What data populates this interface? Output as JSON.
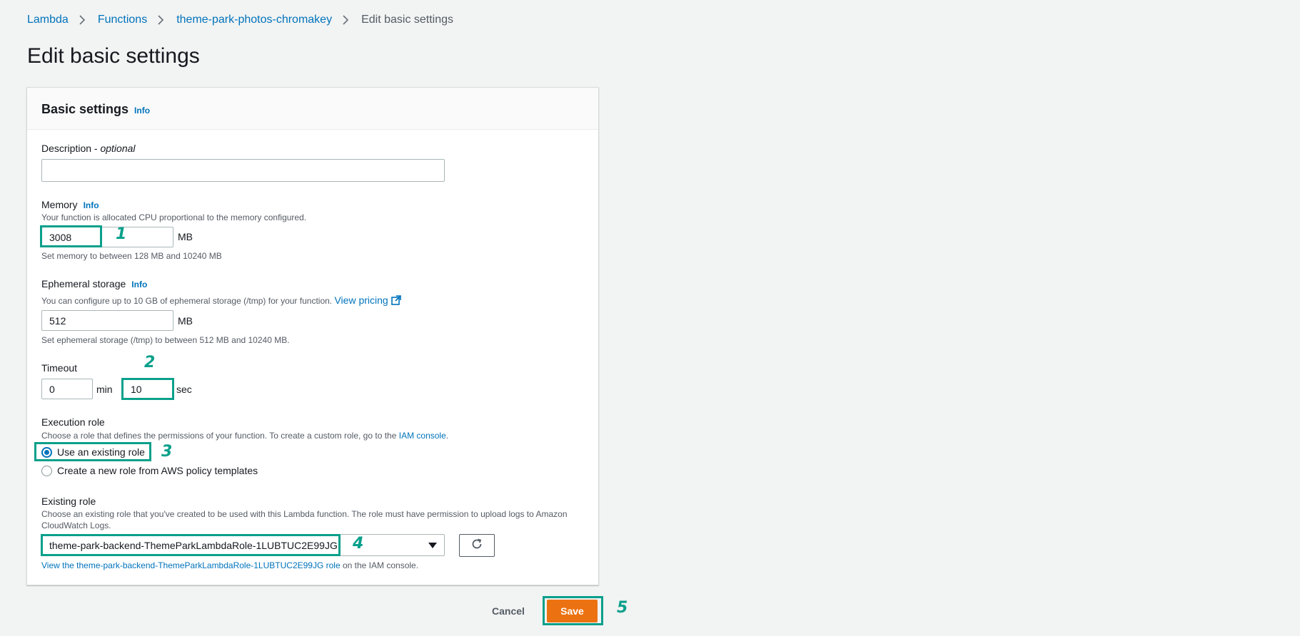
{
  "breadcrumb": {
    "items": [
      "Lambda",
      "Functions",
      "theme-park-photos-chromakey"
    ],
    "current": "Edit basic settings"
  },
  "page_title": "Edit basic settings",
  "panel": {
    "title": "Basic settings",
    "info": "Info"
  },
  "description": {
    "label": "Description - ",
    "optional": "optional",
    "value": ""
  },
  "memory": {
    "label": "Memory",
    "info": "Info",
    "help": "Your function is allocated CPU proportional to the memory configured.",
    "value": "3008",
    "unit": "MB",
    "constraint": "Set memory to between 128 MB and 10240 MB"
  },
  "ephemeral": {
    "label": "Ephemeral storage",
    "info": "Info",
    "help": "You can configure up to 10 GB of ephemeral storage (/tmp) for your function.",
    "pricing_link": "View pricing",
    "value": "512",
    "unit": "MB",
    "constraint": "Set ephemeral storage (/tmp) to between 512 MB and 10240 MB."
  },
  "timeout": {
    "label": "Timeout",
    "min_value": "0",
    "min_unit": "min",
    "sec_value": "10",
    "sec_unit": "sec"
  },
  "execution_role": {
    "label": "Execution role",
    "help_prefix": "Choose a role that defines the permissions of your function. To create a custom role, go to the",
    "iam_link": "IAM console",
    "help_suffix": ".",
    "options": [
      "Use an existing role",
      "Create a new role from AWS policy templates"
    ],
    "selected": "Use an existing role"
  },
  "existing_role": {
    "label": "Existing role",
    "help_line1": "Choose an existing role that you've created to be used with this Lambda function. The role must have permission to upload logs to Amazon",
    "help_line2": "CloudWatch Logs.",
    "value": "theme-park-backend-ThemeParkLambdaRole-1LUBTUC2E99JG",
    "view_link": "View the theme-park-backend-ThemeParkLambdaRole-1LUBTUC2E99JG role",
    "view_suffix": " on the IAM console."
  },
  "actions": {
    "cancel": "Cancel",
    "save": "Save"
  },
  "annotations": [
    "1",
    "2",
    "3",
    "4",
    "5"
  ],
  "colors": {
    "highlight": "#0aa08b",
    "save": "#ec7211",
    "link": "#0073bb"
  }
}
